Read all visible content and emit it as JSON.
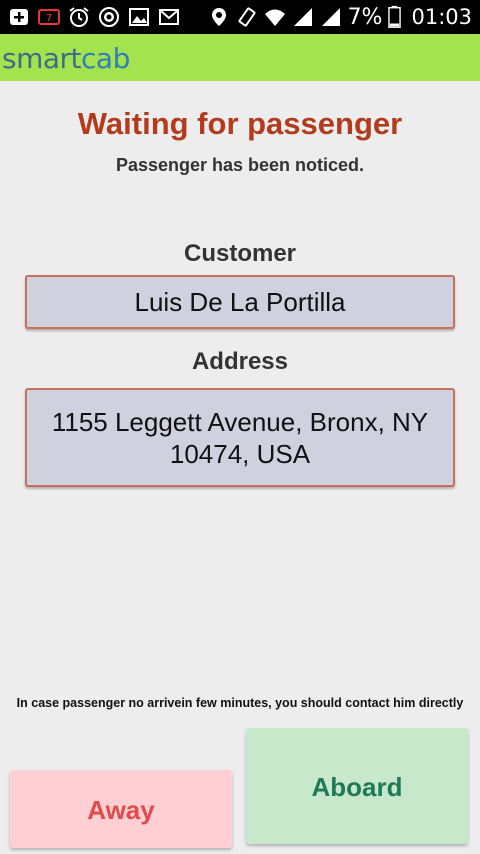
{
  "status_bar": {
    "battery_percent": "7%",
    "time": "01:03",
    "left_icons": [
      "add-icon",
      "notification-badge-icon",
      "alarm-clock-icon",
      "shazam-icon",
      "image-icon",
      "gmail-icon"
    ],
    "right_icons": [
      "location-pin-icon",
      "vibrate-icon",
      "wifi-icon",
      "signal-icon",
      "signal-icon",
      "battery-icon"
    ]
  },
  "app_bar": {
    "logo_smart": "smart",
    "logo_cab": "cab"
  },
  "main": {
    "title": "Waiting for passenger",
    "subtitle": "Passenger has been noticed.",
    "customer_label": "Customer",
    "customer_value": "Luis De La Portilla",
    "address_label": "Address",
    "address_line1": "1155 Leggett Avenue, Bronx, NY",
    "address_line2": "10474, USA",
    "note": "In case passenger no arrivein few minutes, you should contact him directly"
  },
  "buttons": {
    "away": "Away",
    "aboard": "Aboard"
  },
  "colors": {
    "title": "#b13b1c",
    "app_bar": "#a4e24e",
    "field_bg": "#cfd2de",
    "field_border": "#c7705a",
    "away_bg": "#ffcfd4",
    "away_text": "#e04b4b",
    "aboard_bg": "#c8e8cc",
    "aboard_text": "#1f7a5a"
  }
}
